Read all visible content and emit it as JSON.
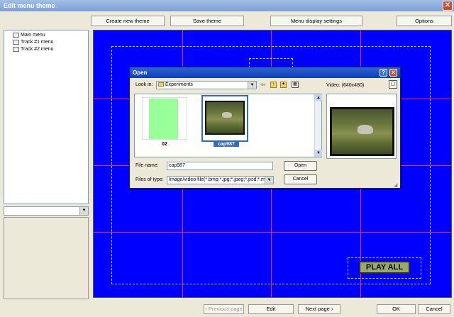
{
  "window": {
    "title": "Edit menu theme"
  },
  "toolbar": {
    "create": "Create new theme",
    "save": "Save theme",
    "display": "Menu display settings",
    "options": "Options"
  },
  "tree": {
    "items": [
      "Main menu",
      "Track #1 menu",
      "Track #2 menu"
    ]
  },
  "canvas": {
    "button_label": "PLAY ALL",
    "colors": {
      "background": "#0000ff",
      "grid": "#ff2a2a"
    }
  },
  "bottom": {
    "prev": "‹ Previous page",
    "edit": "Edit",
    "next": "Next page ›",
    "ok": "OK",
    "cancel": "Cancel"
  },
  "dialog": {
    "title": "Open",
    "look_in_label": "Look in:",
    "look_in_value": "Experiments",
    "preview_label": "Video: (640x480)",
    "files": [
      {
        "name": "02"
      },
      {
        "name": "cap987"
      }
    ],
    "file_name_label": "File name:",
    "file_name_value": "cap987",
    "files_of_type_label": "Files of type:",
    "files_of_type_value": "Image/video file(*.bmp;*.jpg;*.jpeg;*.psd;*.mp",
    "open_button": "Open",
    "cancel_button": "Cancel"
  }
}
